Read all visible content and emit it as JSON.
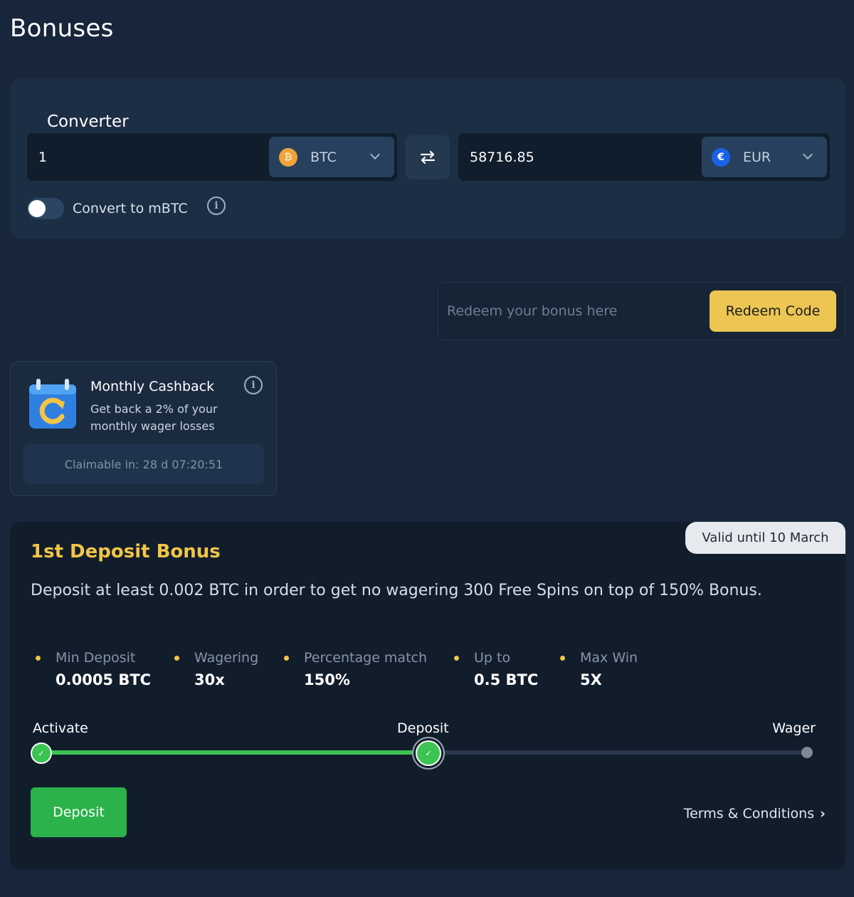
{
  "page": {
    "title": "Bonuses"
  },
  "converter": {
    "title": "Converter",
    "from_value": "1",
    "from_currency": "BTC",
    "from_icon": "bitcoin-icon",
    "to_value": "58716.85",
    "to_currency": "EUR",
    "to_icon": "euro-icon",
    "swap_icon": "swap-arrows-icon",
    "toggle_label": "Convert to mBTC",
    "toggle_on": false
  },
  "redeem": {
    "placeholder": "Redeem your bonus here",
    "button_label": "Redeem Code"
  },
  "cashback": {
    "title": "Monthly Cashback",
    "description": "Get back a 2% of your monthly wager losses",
    "claimable": "Claimable in: 28 d 07:20:51",
    "icon": "calendar-refresh-icon"
  },
  "deposit_bonus": {
    "valid_until": "Valid until 10 March",
    "title": "1st Deposit Bonus",
    "description": "Deposit at least 0.002 BTC in order to get no wagering 300 Free Spins on top of 150% Bonus.",
    "stats": [
      {
        "label": "Min Deposit",
        "value": "0.0005 BTC"
      },
      {
        "label": "Wagering",
        "value": "30x"
      },
      {
        "label": "Percentage match",
        "value": "150%"
      },
      {
        "label": "Up to",
        "value": "0.5 BTC"
      },
      {
        "label": "Max Win",
        "value": "5X"
      }
    ],
    "steps": [
      {
        "label": "Activate",
        "done": true
      },
      {
        "label": "Deposit",
        "done": true
      },
      {
        "label": "Wager",
        "done": false
      }
    ],
    "progress": 0.5,
    "deposit_button": "Deposit",
    "terms_link": "Terms & Conditions"
  },
  "colors": {
    "background": "#17263a",
    "accent_yellow": "#ecc553",
    "success_green": "#2bb24a"
  }
}
